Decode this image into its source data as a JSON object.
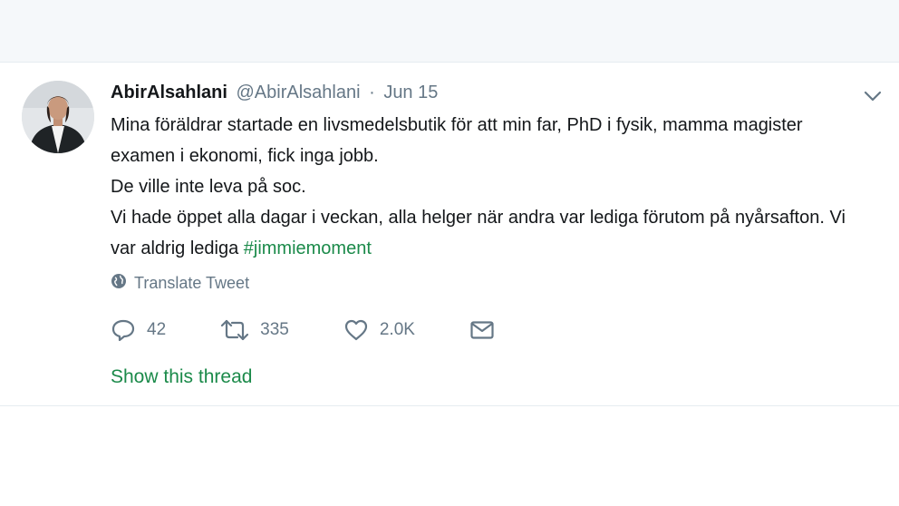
{
  "tweet": {
    "fullname": "AbirAlsahlani",
    "screenname": "@AbirAlsahlani",
    "separator": "·",
    "date": "Jun 15",
    "lines": [
      "Mina föräldrar startade en livsmedelsbutik för att min far, PhD i fysik, mamma magister examen i ekonomi, fick inga jobb.",
      "De ville inte leva på soc.",
      "Vi hade öppet alla dagar i veckan, alla helger när andra var lediga förutom på nyårsafton. Vi var aldrig lediga "
    ],
    "hashtag": "#jimmiemoment",
    "translate_label": "Translate Tweet",
    "actions": {
      "reply_count": "42",
      "retweet_count": "335",
      "like_count": "2.0K"
    },
    "show_thread": "Show this thread"
  },
  "colors": {
    "accent": "#1b8a4a",
    "muted": "#657786",
    "text": "#14171a",
    "background_strip": "#f5f8fa"
  },
  "icons": [
    "chevron-down-icon",
    "globe-icon",
    "reply-icon",
    "retweet-icon",
    "like-icon",
    "direct-message-icon"
  ]
}
